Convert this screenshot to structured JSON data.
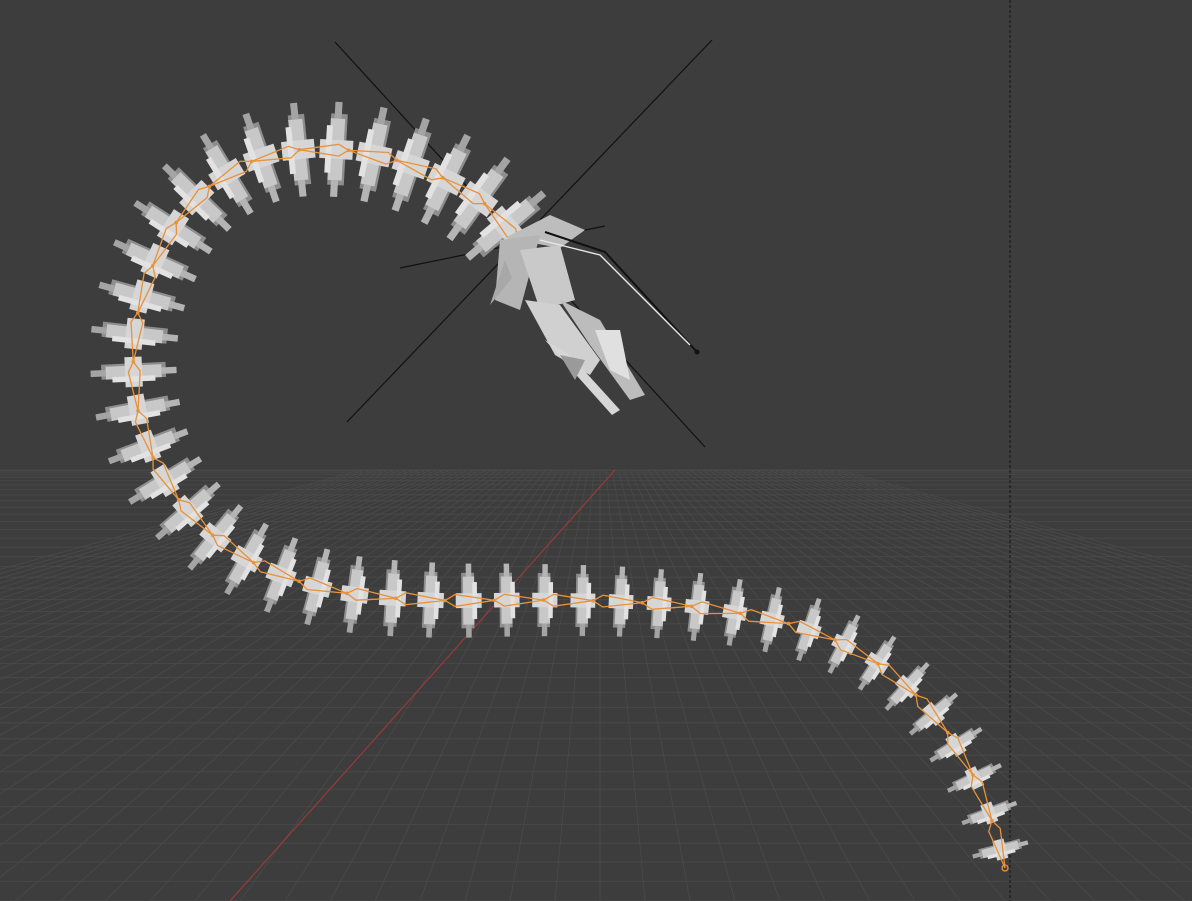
{
  "app": "3D viewport",
  "viewport": {
    "background_color": "#3d3d3d",
    "grid_color": "#4a4a4a",
    "x_axis_color": "#a8393d",
    "mesh_color": "#c8c8c8",
    "mesh_shadow_color": "#8e8e8e",
    "bone_outline_color": "#e8923a",
    "empty_color": "#111111",
    "tail_segments": 44
  }
}
